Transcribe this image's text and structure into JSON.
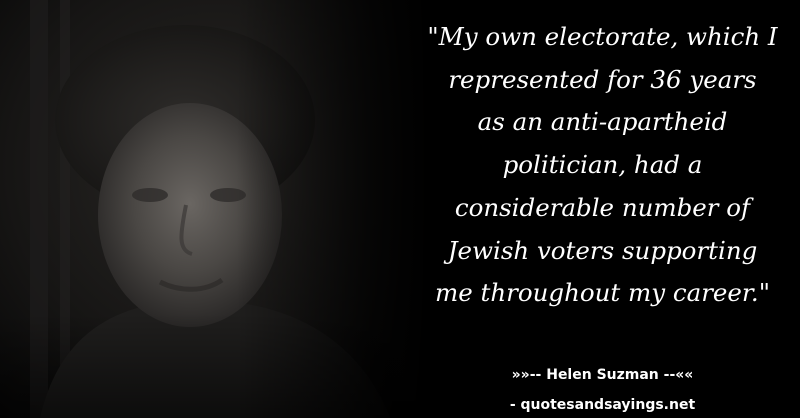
{
  "quote": {
    "lines": [
      "\"My own electorate, which I",
      "represented for 36 years",
      "as an anti-apartheid",
      "politician, had a",
      "considerable number of",
      "Jewish voters supporting",
      "me throughout my career.\""
    ]
  },
  "attribution": {
    "text": "»»-- Helen Suzman --««"
  },
  "source": {
    "text": "- quotesandsayings.net"
  },
  "colors": {
    "background": "#000000",
    "text": "#ffffff"
  }
}
